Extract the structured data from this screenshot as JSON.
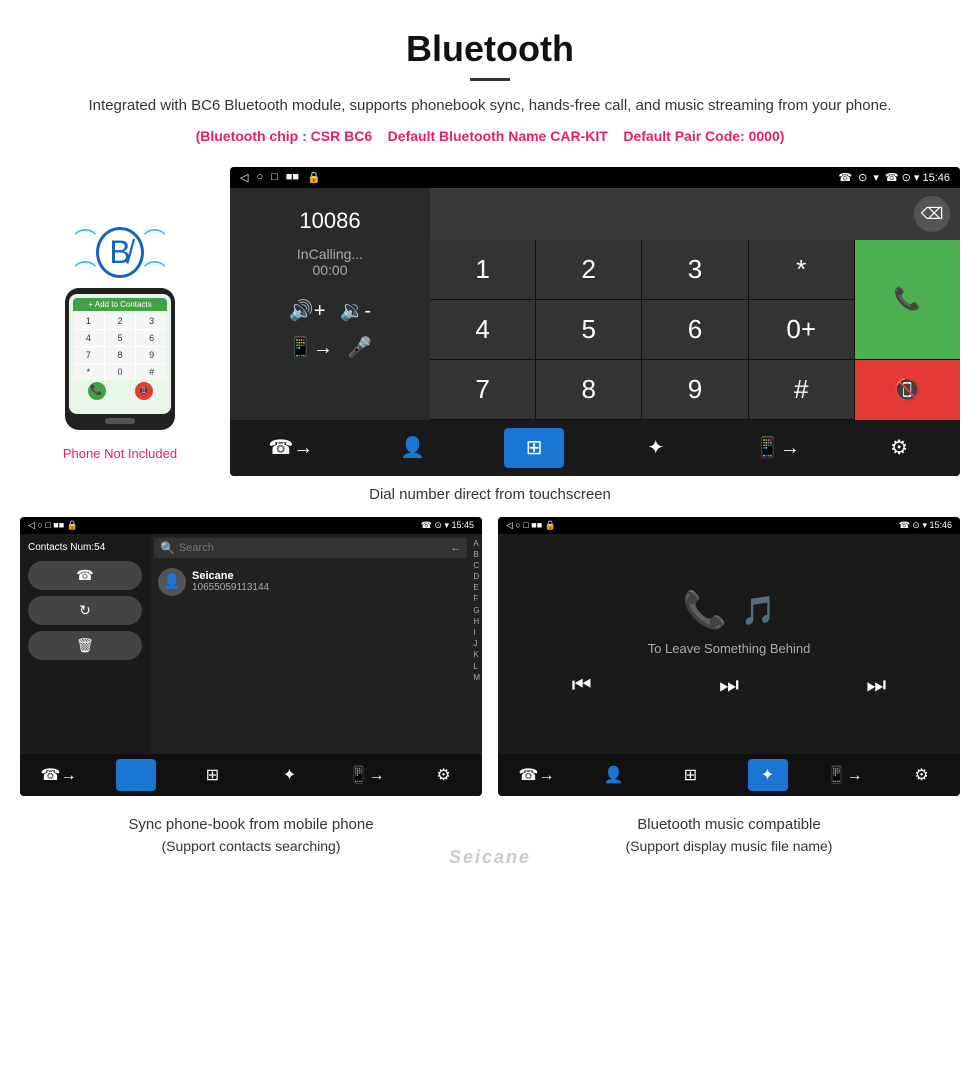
{
  "header": {
    "title": "Bluetooth",
    "description": "Integrated with BC6 Bluetooth module, supports phonebook sync, hands-free call, and music streaming from your phone.",
    "specs": {
      "chip": "(Bluetooth chip : CSR BC6",
      "name": "Default Bluetooth Name CAR-KIT",
      "pair": "Default Pair Code: 0000)"
    }
  },
  "main_screen": {
    "status_bar": {
      "left": [
        "◁",
        "○",
        "□"
      ],
      "right": "☎ ⊙ ▾ 15:46",
      "sim_icon": "■■"
    },
    "dialer": {
      "number": "10086",
      "status": "InCalling...",
      "timer": "00:00",
      "keys": [
        "1",
        "2",
        "3",
        "*",
        "4",
        "5",
        "6",
        "0+",
        "7",
        "8",
        "9",
        "#"
      ],
      "backspace": "⌫"
    },
    "bottom_nav": [
      "☎→",
      "👤",
      "⊞",
      "✦",
      "📱→",
      "⚙"
    ]
  },
  "caption_main": "Dial number direct from touchscreen",
  "contacts_screen": {
    "status": "☎ ⊙ ▾ 15:45",
    "contacts_num": "Contacts Num:54",
    "action_btns": [
      "☎",
      "↻",
      "🗑"
    ],
    "search_placeholder": "Search",
    "contact": {
      "name": "Seicane",
      "number": "10655059113144"
    },
    "alpha": [
      "A",
      "B",
      "C",
      "D",
      "E",
      "F",
      "G",
      "H",
      "I",
      "J",
      "K",
      "L",
      "M"
    ],
    "nav": [
      "☎→",
      "👤",
      "⊞",
      "✦",
      "📱→",
      "⚙"
    ]
  },
  "music_screen": {
    "status": "☎ ⊙ ▾ 15:46",
    "song_title": "To Leave Something Behind",
    "controls": [
      "⏮",
      "⏭",
      "⏭"
    ],
    "nav": [
      "☎→",
      "👤",
      "⊞",
      "✦",
      "📱→",
      "⚙"
    ]
  },
  "caption_contacts": {
    "main": "Sync phone-book from mobile phone",
    "sub": "(Support contacts searching)"
  },
  "caption_music": {
    "main": "Bluetooth music compatible",
    "sub": "(Support display music file name)"
  },
  "phone_label": "Phone Not Included",
  "watermark": "Seicane"
}
